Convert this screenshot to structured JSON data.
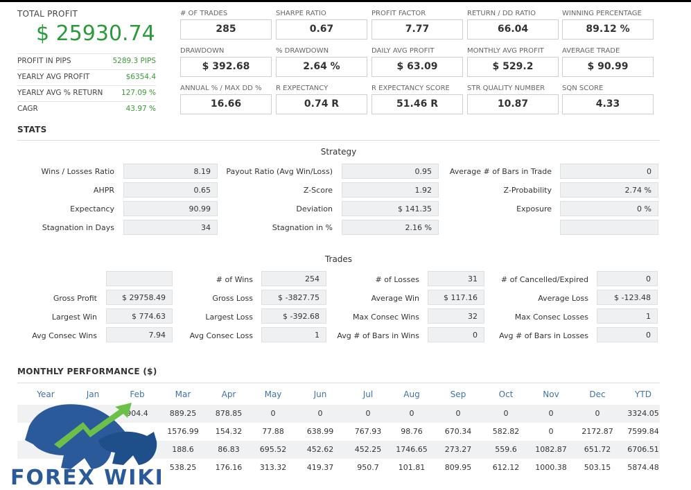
{
  "summary": {
    "total_profit_label": "TOTAL PROFIT",
    "total_profit_value": "$ 25930.74",
    "rows": [
      {
        "label": "PROFIT IN PIPS",
        "value": "5289.3 PIPS"
      },
      {
        "label": "YEARLY AVG PROFIT",
        "value": "$6354.4"
      },
      {
        "label": "YEARLY AVG % RETURN",
        "value": "127.09 %"
      },
      {
        "label": "CAGR",
        "value": "43.97 %"
      }
    ]
  },
  "metrics": [
    {
      "label": "# OF TRADES",
      "value": "285"
    },
    {
      "label": "SHARPE RATIO",
      "value": "0.67"
    },
    {
      "label": "PROFIT FACTOR",
      "value": "7.77"
    },
    {
      "label": "RETURN / DD RATIO",
      "value": "66.04"
    },
    {
      "label": "WINNING PERCENTAGE",
      "value": "89.12 %"
    },
    {
      "label": "DRAWDOWN",
      "value": "$ 392.68"
    },
    {
      "label": "% DRAWDOWN",
      "value": "2.64 %"
    },
    {
      "label": "DAILY AVG PROFIT",
      "value": "$ 63.09"
    },
    {
      "label": "MONTHLY AVG PROFIT",
      "value": "$ 529.2"
    },
    {
      "label": "AVERAGE TRADE",
      "value": "$ 90.99"
    },
    {
      "label": "ANNUAL % / MAX DD %",
      "value": "16.66"
    },
    {
      "label": "R EXPECTANCY",
      "value": "0.74 R"
    },
    {
      "label": "R EXPECTANCY SCORE",
      "value": "51.46 R"
    },
    {
      "label": "STR QUALITY NUMBER",
      "value": "10.87"
    },
    {
      "label": "SQN SCORE",
      "value": "4.33"
    }
  ],
  "stats": {
    "title": "STATS",
    "strategy_caption": "Strategy",
    "strategy": [
      [
        {
          "k": "Wins / Losses Ratio",
          "v": "8.19"
        },
        {
          "k": "Payout Ratio (Avg Win/Loss)",
          "v": "0.95"
        },
        {
          "k": "Average # of Bars in Trade",
          "v": "0"
        }
      ],
      [
        {
          "k": "AHPR",
          "v": "0.65"
        },
        {
          "k": "Z-Score",
          "v": "1.92"
        },
        {
          "k": "Z-Probability",
          "v": "2.74 %"
        }
      ],
      [
        {
          "k": "Expectancy",
          "v": "90.99"
        },
        {
          "k": "Deviation",
          "v": "$ 141.35"
        },
        {
          "k": "Exposure",
          "v": "0 %"
        }
      ],
      [
        {
          "k": "Stagnation in Days",
          "v": "34"
        },
        {
          "k": "Stagnation in %",
          "v": "2.16 %"
        },
        {
          "k": "",
          "v": ""
        }
      ]
    ],
    "trades_caption": "Trades",
    "trades": [
      [
        {
          "k": "",
          "v": ""
        },
        {
          "k": "# of Wins",
          "v": "254"
        },
        {
          "k": "# of Losses",
          "v": "31"
        },
        {
          "k": "# of Cancelled/Expired",
          "v": "0"
        }
      ],
      [
        {
          "k": "Gross Profit",
          "v": "$ 29758.49"
        },
        {
          "k": "Gross Loss",
          "v": "$ -3827.75"
        },
        {
          "k": "Average Win",
          "v": "$ 117.16"
        },
        {
          "k": "Average Loss",
          "v": "$ -123.48"
        }
      ],
      [
        {
          "k": "Largest Win",
          "v": "$ 774.63"
        },
        {
          "k": "Largest Loss",
          "v": "$ -392.68"
        },
        {
          "k": "Max Consec Wins",
          "v": "32"
        },
        {
          "k": "Max Consec Losses",
          "v": "1"
        }
      ],
      [
        {
          "k": "Avg Consec Wins",
          "v": "7.94"
        },
        {
          "k": "Avg Consec Loss",
          "v": "1"
        },
        {
          "k": "Avg # of Bars in Wins",
          "v": "0"
        },
        {
          "k": "Avg # of Bars in Losses",
          "v": "0"
        }
      ]
    ]
  },
  "monthly": {
    "title": "MONTHLY PERFORMANCE ($)",
    "headers": [
      "Year",
      "Jan",
      "Feb",
      "Mar",
      "Apr",
      "May",
      "Jun",
      "Jul",
      "Aug",
      "Sep",
      "Oct",
      "Nov",
      "Dec",
      "YTD"
    ],
    "rows": [
      [
        "",
        "",
        "904.4",
        "889.25",
        "878.85",
        "0",
        "0",
        "0",
        "0",
        "0",
        "0",
        "0",
        "0",
        "3324.05"
      ],
      [
        "",
        "",
        "",
        "1576.99",
        "154.32",
        "77.88",
        "638.99",
        "767.93",
        "98.76",
        "670.34",
        "582.82",
        "0",
        "2172.87",
        "7599.84"
      ],
      [
        "",
        "",
        "",
        "188.6",
        "86.83",
        "695.52",
        "452.62",
        "452.25",
        "1746.65",
        "273.27",
        "559.6",
        "1082.87",
        "651.72",
        "6706.51"
      ],
      [
        "",
        "",
        "",
        "538.25",
        "176.16",
        "313.32",
        "419.37",
        "950.7",
        "101.81",
        "809.95",
        "612.12",
        "1000.38",
        "503.15",
        "5874.48"
      ]
    ]
  },
  "logo": {
    "text": "FOREX WIKI"
  },
  "colors": {
    "accent_green": "#2a9a3a",
    "header_blue": "#3f73a8",
    "logo_blue": "#2a5a9a"
  }
}
